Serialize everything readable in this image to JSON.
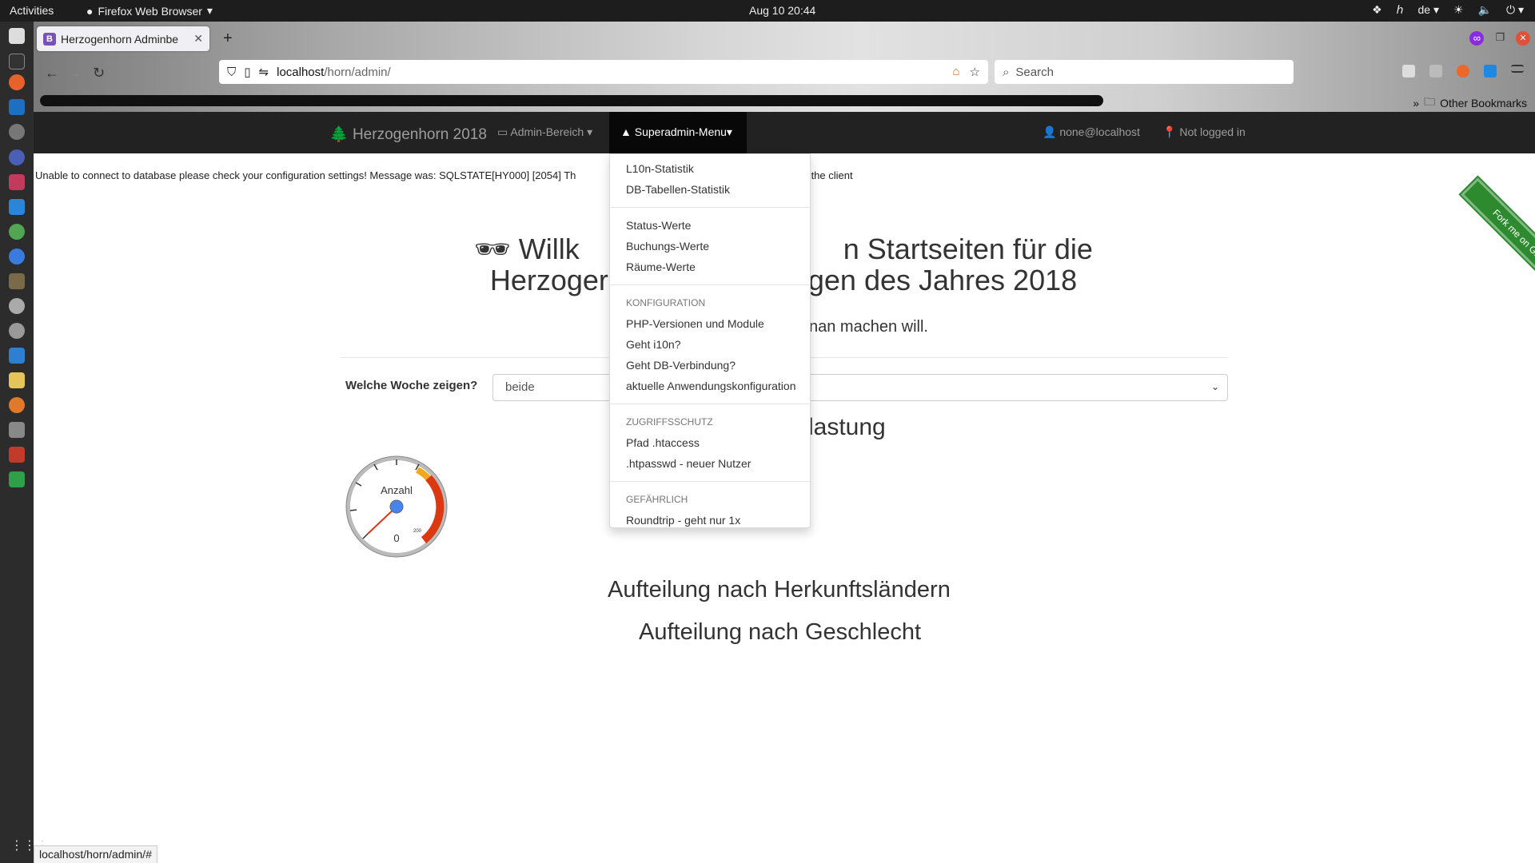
{
  "topbar": {
    "activities": "Activities",
    "app_name": "Firefox Web Browser",
    "clock": "Aug 10  20:44",
    "lang": "de"
  },
  "browser": {
    "tab_title": "Herzogenhorn Adminbe",
    "url_host": "localhost",
    "url_path": "/horn/admin/",
    "search_placeholder": "Search",
    "other_bookmarks": "Other Bookmarks",
    "status_url": "localhost/horn/admin/#"
  },
  "navbar": {
    "brand": "Herzogenhorn 2018",
    "admin": "Admin-Bereich",
    "superadmin": "Superadmin-Menu",
    "user": "none@localhost",
    "login": "Not logged in"
  },
  "content": {
    "error": "Unable to connect to database please check your configuration settings! Message was: SQLSTATE[HY000] [2054] Th",
    "error_tail": "od unknown to the client",
    "title_line1": "🕶 Willk",
    "title_line1b": "n Startseiten für die",
    "title_line2": "Herzoger",
    "title_line2b": "gen des Jahres 2018",
    "subtitle": "nan machen will.",
    "week_label": "Welche Woche zeigen?",
    "week_value": "beide",
    "auslastung": "lastung",
    "gauge_label": "Anzahl",
    "gauge_value": "0",
    "gauge_max": "200",
    "herkunft": "Aufteilung nach Herkunftsländern",
    "geschlecht": "Aufteilung nach Geschlecht",
    "ribbon": "Fork me on GitHub"
  },
  "dropdown": {
    "l10n": "L10n-Statistik",
    "dbstats": "DB-Tabellen-Statistik",
    "status": "Status-Werte",
    "buchung": "Buchungs-Werte",
    "raeume": "Räume-Werte",
    "hdr_config": "KONFIGURATION",
    "php": "PHP-Versionen und Module",
    "i10n": "Geht i10n?",
    "db": "Geht DB-Verbindung?",
    "appconf": "aktuelle Anwendungskonfiguration",
    "hdr_access": "ZUGRIFFSSCHUTZ",
    "htaccess": "Pfad .htaccess",
    "htpasswd": ".htpasswd - neuer Nutzer",
    "hdr_danger": "GEFÄHRLICH",
    "roundtrip": "Roundtrip - geht nur 1x"
  }
}
